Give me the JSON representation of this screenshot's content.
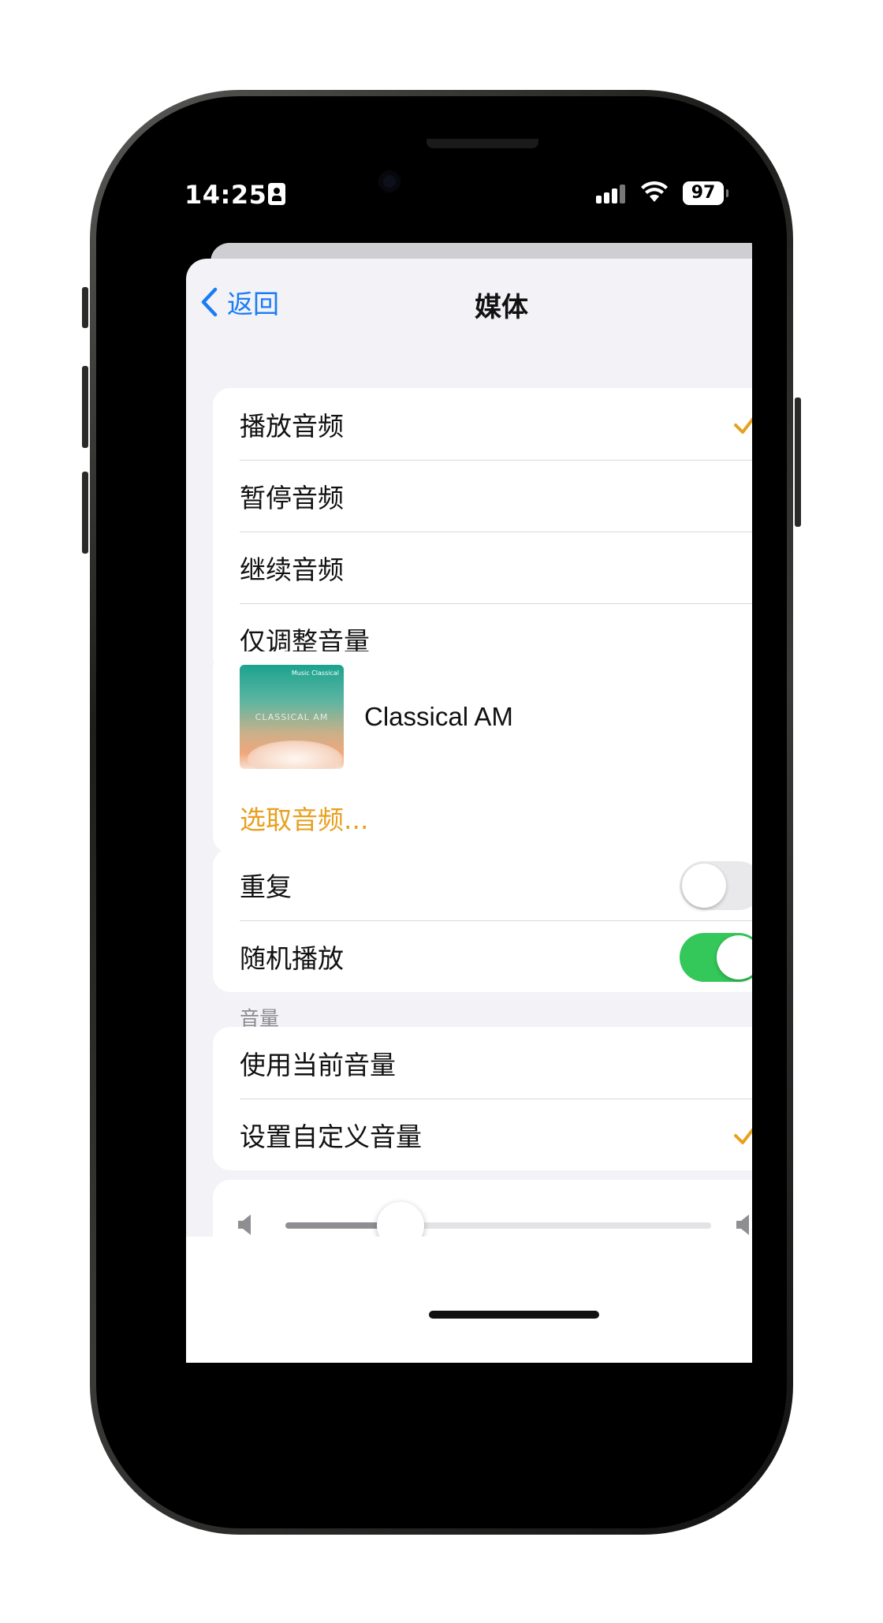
{
  "status_bar": {
    "time": "14:25",
    "battery": "97"
  },
  "nav": {
    "back_label": "返回",
    "title": "媒体"
  },
  "action_group": {
    "items": [
      {
        "label": "播放音频",
        "selected": true
      },
      {
        "label": "暂停音频",
        "selected": false
      },
      {
        "label": "继续音频",
        "selected": false
      },
      {
        "label": "仅调整音量",
        "selected": false
      }
    ]
  },
  "media_group": {
    "title": "Classical AM",
    "artwork_brand": "Music Classical",
    "artwork_text": "CLASSICAL AM",
    "choose_label": "选取音频..."
  },
  "playback_group": {
    "repeat_label": "重复",
    "repeat_on": false,
    "shuffle_label": "随机播放",
    "shuffle_on": true
  },
  "volume_section": {
    "header": "音量",
    "items": [
      {
        "label": "使用当前音量",
        "selected": false
      },
      {
        "label": "设置自定义音量",
        "selected": true
      }
    ]
  },
  "volume_slider": {
    "value_fraction": 0.27
  },
  "colors": {
    "accent": "#e8a020",
    "link_blue": "#1a7cf5",
    "toggle_on": "#34c759"
  },
  "icons": [
    "chevron-left-icon",
    "checkmark-icon",
    "speaker-low-icon",
    "speaker-high-icon",
    "wifi-icon",
    "signal-icon",
    "battery-icon",
    "id-card-icon"
  ]
}
